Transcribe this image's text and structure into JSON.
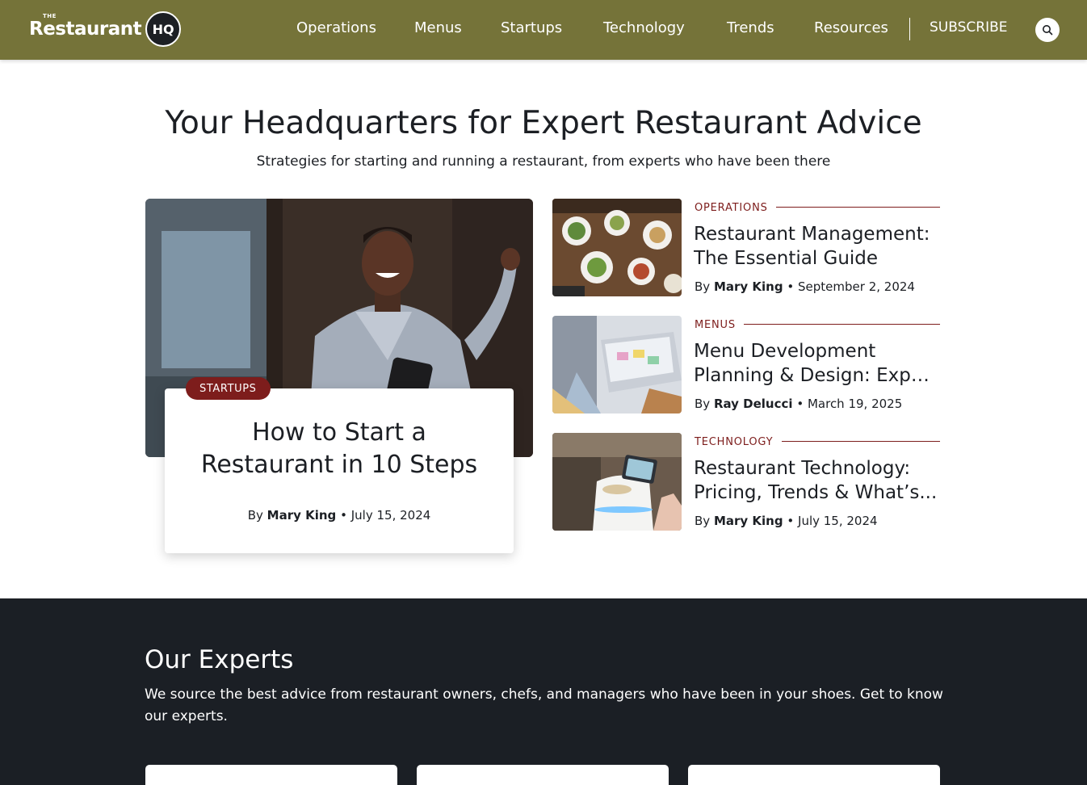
{
  "header": {
    "logo_the": "THE",
    "logo_name": "Restaurant",
    "logo_badge": "HQ",
    "nav": [
      {
        "label": "Operations"
      },
      {
        "label": "Menus"
      },
      {
        "label": "Startups"
      },
      {
        "label": "Technology"
      },
      {
        "label": "Trends"
      },
      {
        "label": "Resources"
      }
    ],
    "subscribe": "SUBSCRIBE",
    "search_icon": "search-icon",
    "colors": {
      "bar": "#757339"
    }
  },
  "hero": {
    "title": "Your Headquarters for Expert Restaurant Advice",
    "subtitle": "Strategies for starting and running a restaurant, from experts who have been there"
  },
  "featured": {
    "category": "STARTUPS",
    "title_line1": "How to Start a",
    "title_line2": "Restaurant in 10 Steps",
    "by": "By",
    "author": "Mary King",
    "date": "July 15, 2024"
  },
  "articles": [
    {
      "category": "OPERATIONS",
      "title_line1": "Restaurant Management:",
      "title_line2": "The Essential Guide",
      "by": "By",
      "author": "Mary King",
      "date": "September 2, 2024"
    },
    {
      "category": "MENUS",
      "title_line1": "Menu Development",
      "title_line2": "Planning & Design: Exper...",
      "by": "By",
      "author": "Ray Delucci",
      "date": "March 19, 2025"
    },
    {
      "category": "TECHNOLOGY",
      "title_line1": "Restaurant Technology:",
      "title_line2": "Pricing, Trends & What’s...",
      "by": "By",
      "author": "Mary King",
      "date": "July 15, 2024"
    }
  ],
  "experts": {
    "title": "Our Experts",
    "description": "We source the best advice from restaurant owners, chefs, and managers who have been in your shoes. Get to know our experts."
  },
  "colors": {
    "accent": "#7d1d1c",
    "dark": "#1b1f25",
    "text": "#1c1f24"
  }
}
